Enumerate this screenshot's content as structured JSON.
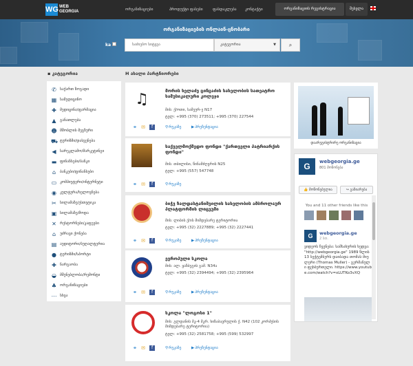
{
  "header": {
    "logo_mark": "WG",
    "logo_line1": "WEB",
    "logo_line2": "GEORGIA",
    "nav": [
      "ორგანიზაციები",
      "პროდუქტი ფასები",
      "ფასდაკლება",
      "კონტაქტი"
    ],
    "register_button": "ორგანიზაციის რეგისტრაცია",
    "login_button": "შესვლა",
    "flag_icon": "uk-flag-icon"
  },
  "hero": {
    "title": "ორგანიზაციების ონლაინ-ცნობარი",
    "lang_label": "ka",
    "search_placeholder": "საძიებო სიტყვა",
    "category_selected": "კატეგორია",
    "search_icon": "search-icon"
  },
  "sidebar": {
    "heading": "კატეგორია",
    "items": [
      {
        "label": "საქართ ზოგადი",
        "icon": "phone-icon"
      },
      {
        "label": "სამედიცინო",
        "icon": "building-icon"
      },
      {
        "label": "მედიცინა/ფარმაცია",
        "icon": "plus-icon"
      },
      {
        "label": "განათლება",
        "icon": "graduation-cap-icon"
      },
      {
        "label": "მშობლის მეგზური",
        "icon": "users-icon"
      },
      {
        "label": "ტურიზმი/დასვენება",
        "icon": "car-icon"
      },
      {
        "label": "სარეკლამო/მარკეტინგი",
        "icon": "bullhorn-icon"
      },
      {
        "label": "ფინანსები/ბანკი",
        "icon": "money-icon"
      },
      {
        "label": "ბანკები/ფინანსები",
        "icon": "bank-icon"
      },
      {
        "label": "კომპიუტერი/ინტერნეტი",
        "icon": "computer-icon"
      },
      {
        "label": "კულტურა/ხელოვნება",
        "icon": "palette-icon"
      },
      {
        "label": "სილამაზე/ესთეტიკა",
        "icon": "scissors-icon"
      },
      {
        "label": "სილამაზე/მოდა",
        "icon": "shopping-bag-icon"
      },
      {
        "label": "რესტორნები/კაფეები",
        "icon": "utensils-icon"
      },
      {
        "label": "უძრავი ქონება",
        "icon": "house-icon"
      },
      {
        "label": "აუდიტორი/ბუღალტერია",
        "icon": "briefcase-icon"
      },
      {
        "label": "ტურიზმი/სპორტი",
        "icon": "ball-icon"
      },
      {
        "label": "ნარგაობა",
        "icon": "tools-icon"
      },
      {
        "label": "მშენებლობა/რემონტი",
        "icon": "helmet-icon"
      },
      {
        "label": "ორგანიზაციები",
        "icon": "tree-icon"
      },
      {
        "label": "სხვა",
        "icon": "dots-icon"
      }
    ]
  },
  "listings": {
    "heading": "ახალი პარტნიორები",
    "items": [
      {
        "name": "მორის ხელაძე ცინცაძის სახელობის სათეატრო სამუსიკალური კოლეჯი",
        "address": "მის: ქ/ოთი, სამეურ-ე N17",
        "phone": "ტელ: +995 (370) 273511; +995 (370) 227544",
        "map_label": "რუკაზე",
        "video_label": "პრეზენტაცია",
        "thumb_icon": "music-notes-icon"
      },
      {
        "name": "საქველმოქმედო ფონდი \"ქართველი პატრიარქის ფონდი\"",
        "address": "მის: თბილისი, წინამძღვრის N25",
        "phone": "ტელ: +995 (557) 547748",
        "map_label": "რუკაზე",
        "video_label": "",
        "thumb_icon": "patriarch-photo-icon"
      },
      {
        "name": "ბიჭვ ზალდასტანიშვილის სახელობის ამბროლაურ პლატფორმის ლიცეუმი",
        "address": "მის: ლიბის ქ/ის მიმდებარე ტერიტორია",
        "phone": "ტელ: +995 (32) 2227889; +995 (32) 2227441",
        "map_label": "რუკაზე",
        "video_label": "პრეზენტაცია",
        "thumb_icon": "school-crest-icon"
      },
      {
        "name": "ევროპული სკოლა",
        "address": "მის: ალ. ყაზბეგის გამ. N34ა",
        "phone": "ტელ: +995 (32) 2394494; +995 (32) 2395964",
        "map_label": "რუკაზე",
        "video_label": "პრეზენტაცია",
        "thumb_icon": "european-school-logo-icon"
      },
      {
        "name": "სკოლა \"ლოგოსი 1\"",
        "address": "მის: გლდანის მკ-4 მკრ. ხიზაბავრულის ქ. N42 (102 კორპუსის მიმდებარე ტერიტორია)",
        "phone": "ტელ: +995 (32) 2581758; +995 (599) 532997",
        "map_label": "რუკაზე",
        "video_label": "პრეზენტაცია",
        "thumb_icon": "logos-school-logo-icon"
      }
    ]
  },
  "right": {
    "ad_caption": "დაარეგისტრირე ორგანიზაცია",
    "fb": {
      "page_name": "webgeorgia.ge",
      "likes": "801 მოწონება",
      "like_button": "მოწონებულია",
      "share_button": "გაზიარება",
      "friends_text": "You and 11 other friends like this",
      "post_name": "webgeorgia.ge",
      "post_time": "2 სთ.",
      "post_text": "ვიდეოს ჩვენება: სამსახურის ხედვა: \"http://webgeorgia.ge\" 1989 წლის 13 სექტემბერს დაიბადა თომას მიულერი (Thomas Muller) - გერმანული ფეხბურთელი. https://www.youtube.com/watch?v=xLUTKo3vXQ"
    }
  }
}
